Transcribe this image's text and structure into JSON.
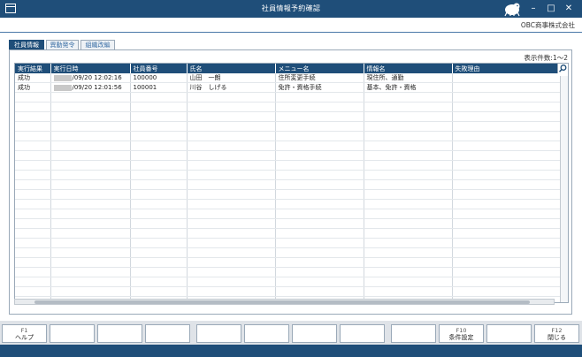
{
  "window": {
    "title": "社員情報予約確認"
  },
  "company": {
    "name": "OBC商事株式会社"
  },
  "tabs": [
    "社員情報",
    "異動発令",
    "組織改編"
  ],
  "count_label": "表示件数:1～2",
  "table": {
    "columns": [
      "実行結果",
      "実行日時",
      "社員番号",
      "氏名",
      "メニュー名",
      "情報名",
      "失敗理由"
    ],
    "rows": [
      [
        "成功",
        "/09/20 12:02:16",
        "100000",
        "山田　一朗",
        "住所変更手続",
        "現住所、通勤",
        ""
      ],
      [
        "成功",
        "/09/20 12:01:56",
        "100001",
        "川谷　しげる",
        "免許・資格手続",
        "基本、免許・資格",
        ""
      ]
    ]
  },
  "fkeys": {
    "f1": {
      "num": "F1",
      "label": "ヘルプ"
    },
    "f10": {
      "num": "F10",
      "label": "条件設定"
    },
    "f12": {
      "num": "F12",
      "label": "閉じる"
    }
  }
}
